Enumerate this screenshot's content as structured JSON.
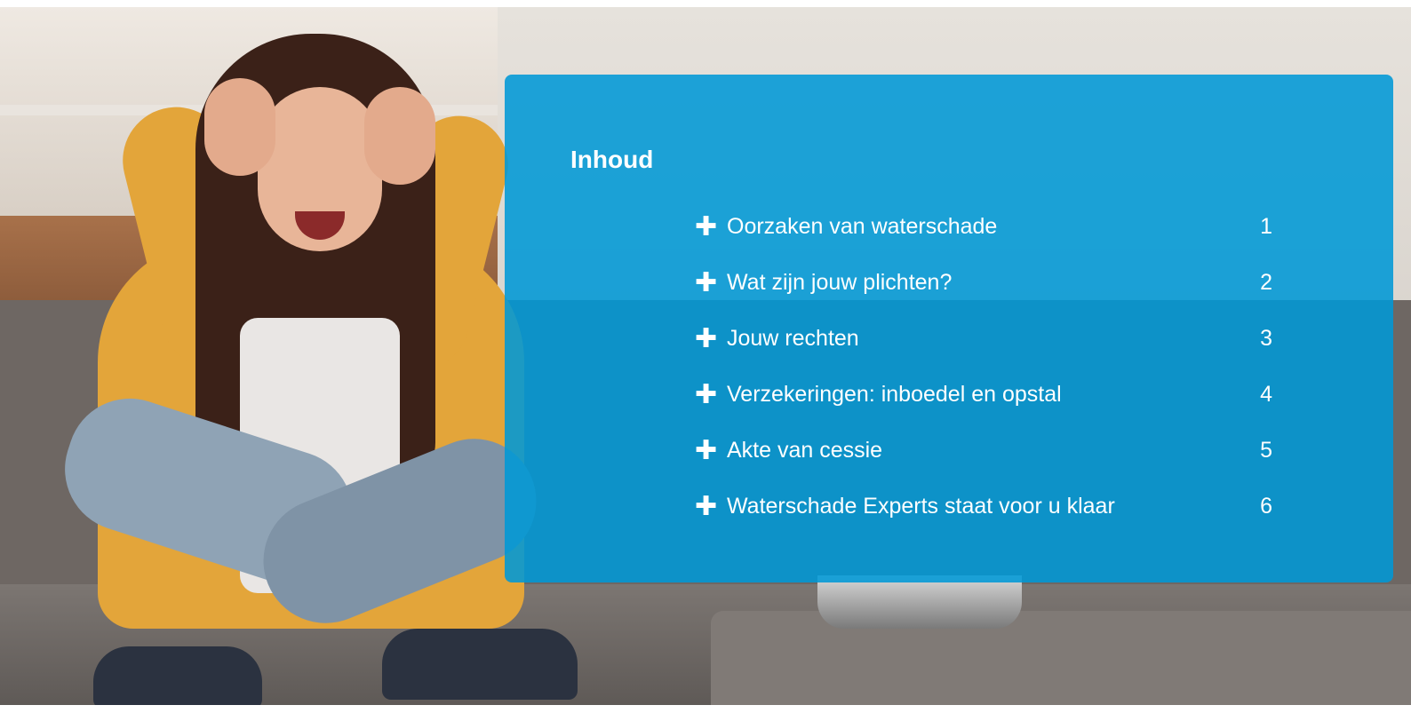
{
  "toc": {
    "title": "Inhoud",
    "items": [
      {
        "label": "Oorzaken van waterschade",
        "number": "1"
      },
      {
        "label": "Wat zijn jouw plichten?",
        "number": "2"
      },
      {
        "label": "Jouw rechten",
        "number": "3"
      },
      {
        "label": "Verzekeringen: inboedel en opstal",
        "number": "4"
      },
      {
        "label": "Akte van cessie",
        "number": "5"
      },
      {
        "label": "Waterschade Experts staat voor u klaar",
        "number": "6"
      }
    ]
  },
  "colors": {
    "panel_background": "#0099D6",
    "text": "#FFFFFF"
  },
  "icons": {
    "item_icon": "plus-icon"
  }
}
